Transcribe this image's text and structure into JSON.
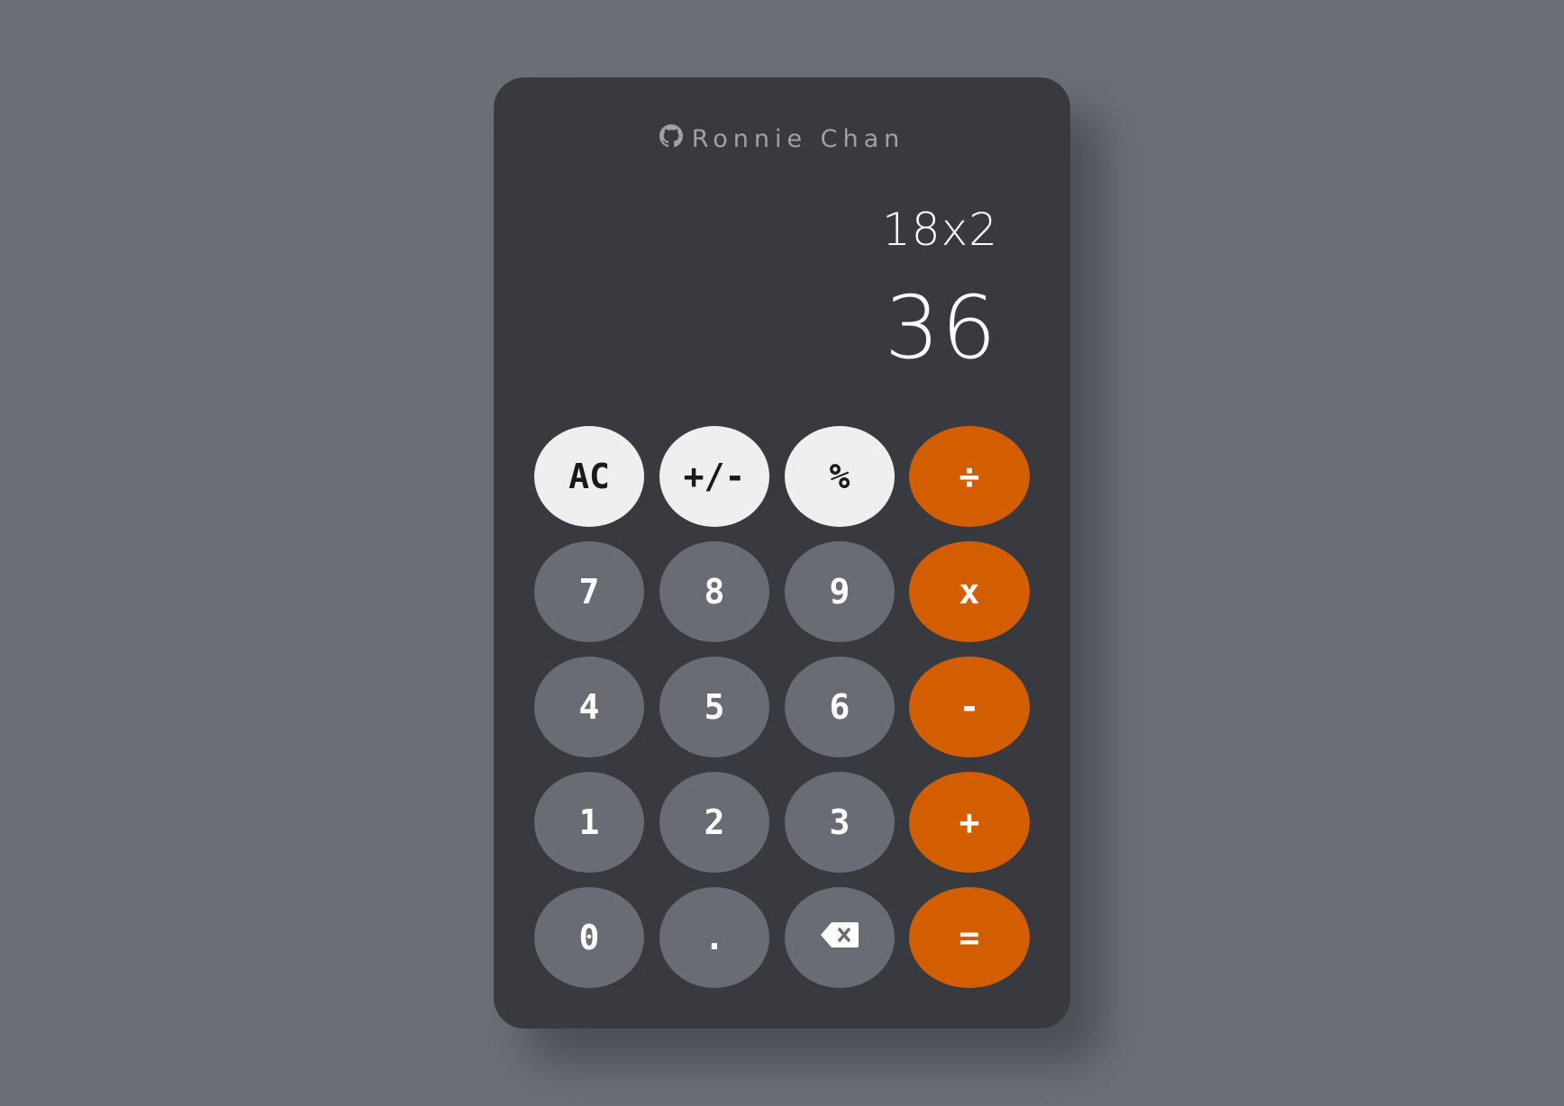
{
  "author": {
    "name": "Ronnie Chan",
    "icon": "github-icon"
  },
  "display": {
    "expression": "18x2",
    "result": "36"
  },
  "keys": {
    "ac": "AC",
    "sign": "+/-",
    "percent": "%",
    "divide": "÷",
    "seven": "7",
    "eight": "8",
    "nine": "9",
    "multiply": "x",
    "four": "4",
    "five": "5",
    "six": "6",
    "subtract": "-",
    "one": "1",
    "two": "2",
    "three": "3",
    "add": "+",
    "zero": "0",
    "decimal": ".",
    "backspace_icon": "backspace-icon",
    "equals": "="
  },
  "colors": {
    "background": "#6a6e76",
    "panel": "#393a40",
    "function_key": "#efefef",
    "digit_key": "#696c75",
    "operator_key": "#d25e00"
  }
}
